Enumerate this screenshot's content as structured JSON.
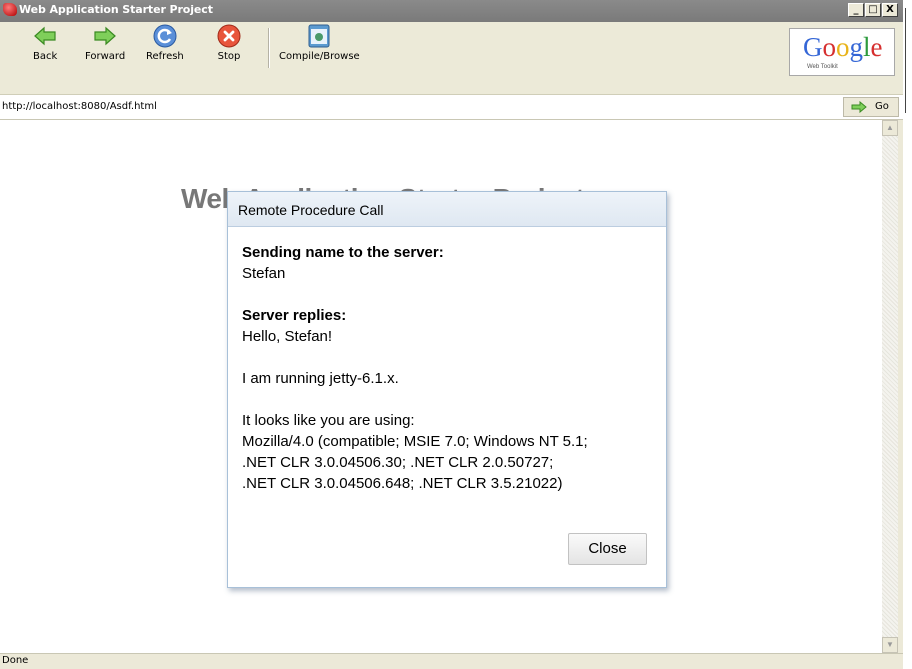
{
  "window": {
    "title": "Web Application Starter Project",
    "controls": [
      "_",
      "□",
      "X"
    ]
  },
  "toolbar": {
    "buttons": [
      {
        "label": "Back",
        "icon": "back-arrow-icon"
      },
      {
        "label": "Forward",
        "icon": "forward-arrow-icon"
      },
      {
        "label": "Refresh",
        "icon": "refresh-icon"
      },
      {
        "label": "Stop",
        "icon": "stop-icon"
      },
      {
        "label": "Compile/Browse",
        "icon": "compile-browse-icon"
      }
    ],
    "logo": {
      "text": "Google",
      "subtext": "Web Toolkit"
    }
  },
  "address_bar": {
    "url": "http://localhost:8080/Asdf.html",
    "go_label": "Go"
  },
  "page": {
    "heading": "Web Application Starter Project"
  },
  "dialog": {
    "title": "Remote Procedure Call",
    "sending_label": "Sending name to the server:",
    "sent_name": "Stefan",
    "replies_label": "Server replies:",
    "reply": "Hello, Stefan!",
    "server_info": "I am running jetty-6.1.x.",
    "ua_label": "It looks like you are using:",
    "ua_lines": [
      "Mozilla/4.0 (compatible; MSIE 7.0; Windows NT 5.1;",
      ".NET CLR 3.0.04506.30; .NET CLR 2.0.50727;",
      ".NET CLR 3.0.04506.648; .NET CLR 3.5.21022)"
    ],
    "close_label": "Close"
  },
  "status": {
    "text": "Done"
  }
}
